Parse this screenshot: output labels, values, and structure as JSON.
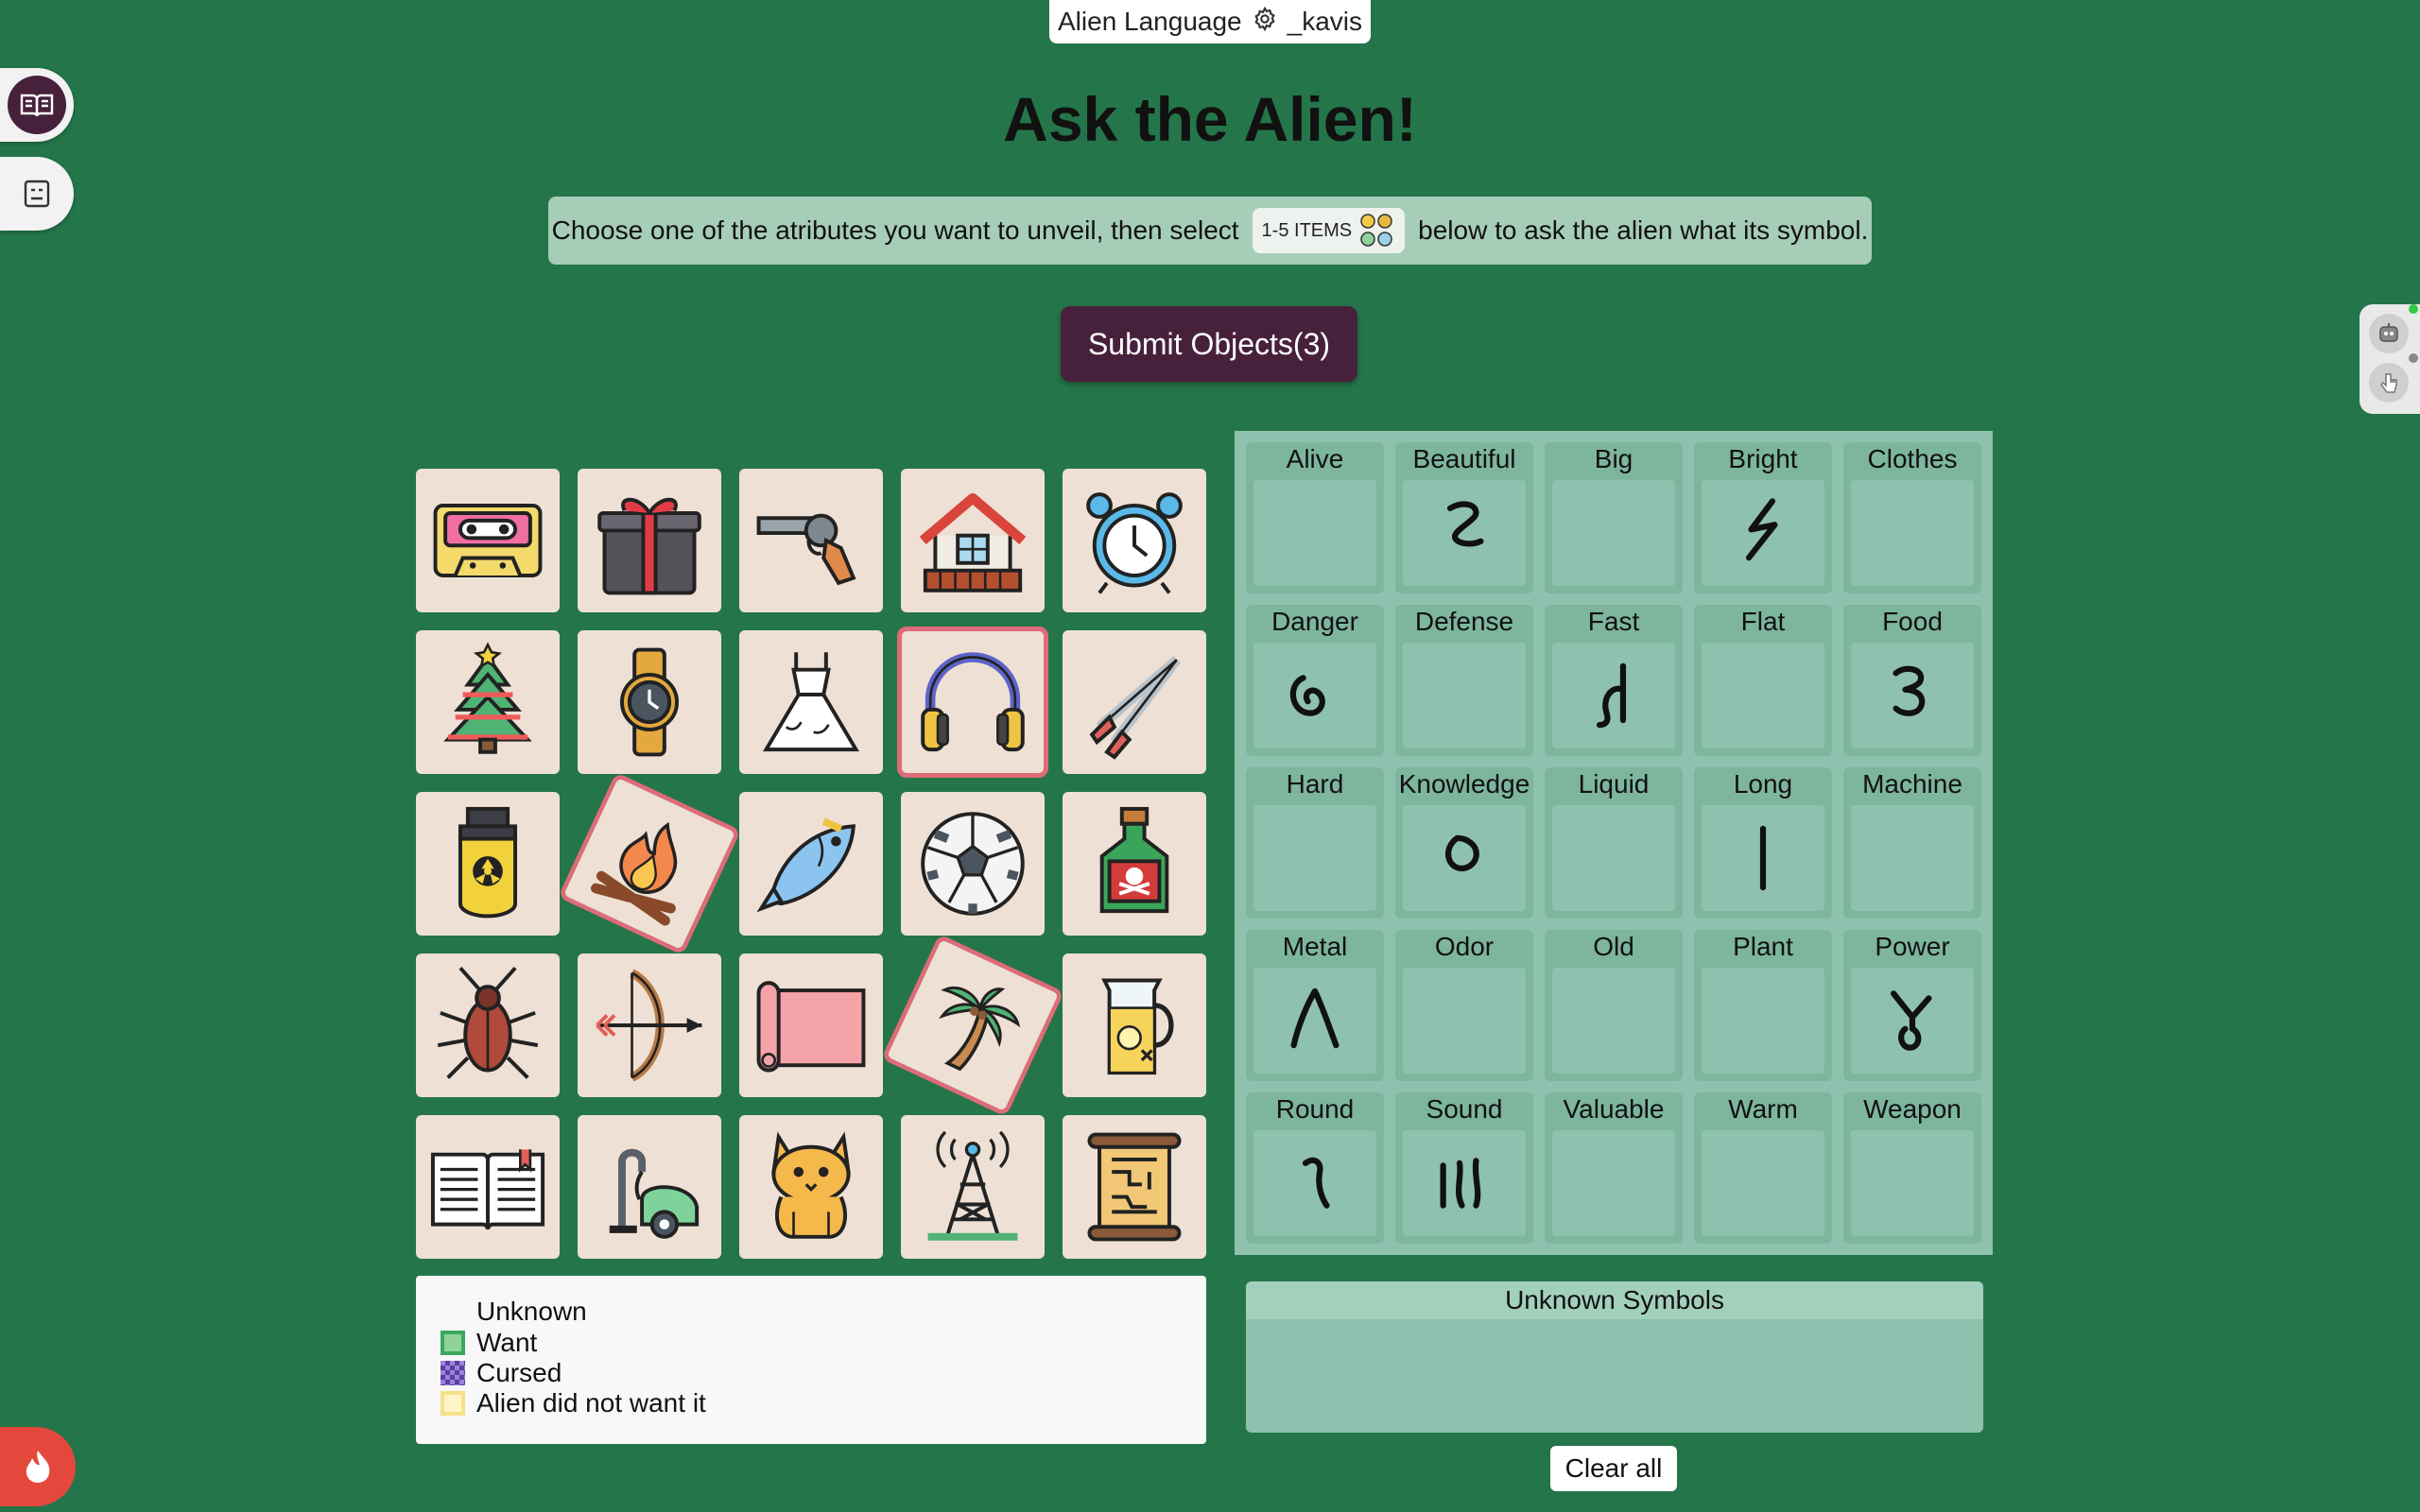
{
  "header": {
    "app_name": "Alien Language",
    "user": "_kavis"
  },
  "heading": "Ask the Alien!",
  "instructions": {
    "before": "Choose one of the atributes you want to unveil, then select",
    "chip": "1-5 ITEMS",
    "after": "below to ask the alien what its symbol."
  },
  "submit_label": "Submit Objects(3)",
  "objects": [
    {
      "name": "cassette-tape",
      "selected": false
    },
    {
      "name": "gift-box",
      "selected": false
    },
    {
      "name": "revolver",
      "selected": false
    },
    {
      "name": "house",
      "selected": false
    },
    {
      "name": "alarm-clock",
      "selected": false
    },
    {
      "name": "christmas-tree",
      "selected": false
    },
    {
      "name": "wristwatch",
      "selected": false
    },
    {
      "name": "wedding-dress",
      "selected": false
    },
    {
      "name": "headphones",
      "selected": true
    },
    {
      "name": "tongs",
      "selected": false
    },
    {
      "name": "nuclear-bomb",
      "selected": false
    },
    {
      "name": "campfire",
      "selected": true
    },
    {
      "name": "fish",
      "selected": false
    },
    {
      "name": "soccer-ball",
      "selected": false
    },
    {
      "name": "poison-bottle",
      "selected": false
    },
    {
      "name": "cockroach",
      "selected": false
    },
    {
      "name": "bow-and-arrow",
      "selected": false
    },
    {
      "name": "yoga-mat",
      "selected": false
    },
    {
      "name": "palm-tree",
      "selected": true
    },
    {
      "name": "lemonade-pitcher",
      "selected": false
    },
    {
      "name": "open-book",
      "selected": false
    },
    {
      "name": "vacuum-cleaner",
      "selected": false
    },
    {
      "name": "cat",
      "selected": false
    },
    {
      "name": "radio-tower",
      "selected": false
    },
    {
      "name": "ancient-scroll",
      "selected": false
    }
  ],
  "attributes": [
    {
      "label": "Alive",
      "symbol": ""
    },
    {
      "label": "Beautiful",
      "symbol": "beautiful-glyph"
    },
    {
      "label": "Big",
      "symbol": ""
    },
    {
      "label": "Bright",
      "symbol": "bright-glyph"
    },
    {
      "label": "Clothes",
      "symbol": ""
    },
    {
      "label": "Danger",
      "symbol": "danger-glyph"
    },
    {
      "label": "Defense",
      "symbol": ""
    },
    {
      "label": "Fast",
      "symbol": "fast-glyph"
    },
    {
      "label": "Flat",
      "symbol": ""
    },
    {
      "label": "Food",
      "symbol": "food-glyph"
    },
    {
      "label": "Hard",
      "symbol": ""
    },
    {
      "label": "Knowledge",
      "symbol": "knowledge-glyph"
    },
    {
      "label": "Liquid",
      "symbol": ""
    },
    {
      "label": "Long",
      "symbol": "long-glyph"
    },
    {
      "label": "Machine",
      "symbol": ""
    },
    {
      "label": "Metal",
      "symbol": "metal-glyph"
    },
    {
      "label": "Odor",
      "symbol": ""
    },
    {
      "label": "Old",
      "symbol": ""
    },
    {
      "label": "Plant",
      "symbol": ""
    },
    {
      "label": "Power",
      "symbol": "power-glyph"
    },
    {
      "label": "Round",
      "symbol": "round-glyph"
    },
    {
      "label": "Sound",
      "symbol": "sound-glyph"
    },
    {
      "label": "Valuable",
      "symbol": ""
    },
    {
      "label": "Warm",
      "symbol": ""
    },
    {
      "label": "Weapon",
      "symbol": ""
    }
  ],
  "legend": {
    "unknown": "Unknown",
    "want": "Want",
    "cursed": "Cursed",
    "not_wanted": "Alien did not want it"
  },
  "unknown_symbols_title": "Unknown Symbols",
  "clear_all_label": "Clear all",
  "colors": {
    "background": "#25754a",
    "submit": "#47213c",
    "selection": "#e06b78",
    "panel": "#8fc2ae",
    "want": "#3ca85e",
    "cursed": "#5a3fa3",
    "not_wanted": "#f6e08a"
  }
}
